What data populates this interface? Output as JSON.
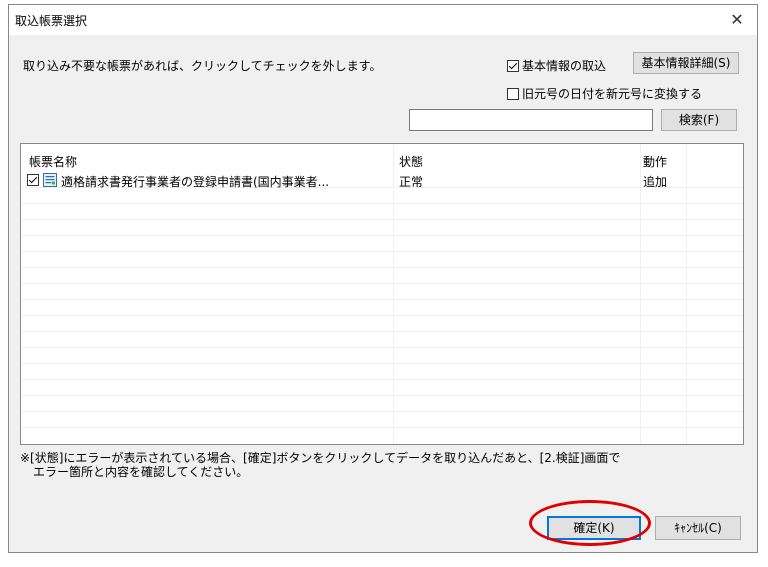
{
  "window": {
    "title": "取込帳票選択",
    "close": "✕"
  },
  "instruction": "取り込み不要な帳票があれば、クリックしてチェックを外します。",
  "options": {
    "basic_info_label": "基本情報の取込",
    "basic_info_checked": true,
    "basic_detail_button": "基本情報詳細(S)",
    "era_convert_label": "旧元号の日付を新元号に変換する",
    "era_convert_checked": false
  },
  "search": {
    "value": "",
    "button": "検索(F)"
  },
  "table": {
    "columns": [
      "帳票名称",
      "状態",
      "動作"
    ],
    "rows": [
      {
        "checked": true,
        "name": "適格請求書発行事業者の登録申請書(国内事業者...",
        "status": "正常",
        "action": "追加",
        "icon": "document-icon"
      }
    ]
  },
  "note": {
    "line1": "※[状態]にエラーが表示されている場合、[確定]ボタンをクリックしてデータを取り込んだあと、[2.検証]画面で",
    "line2": "エラー箇所と内容を確認してください。"
  },
  "buttons": {
    "ok": "確定(K)",
    "cancel": "ｷｬﾝｾﾙ(C)"
  },
  "colors": {
    "highlight_oval": "#e00000",
    "default_button_border": "#0078d7"
  }
}
